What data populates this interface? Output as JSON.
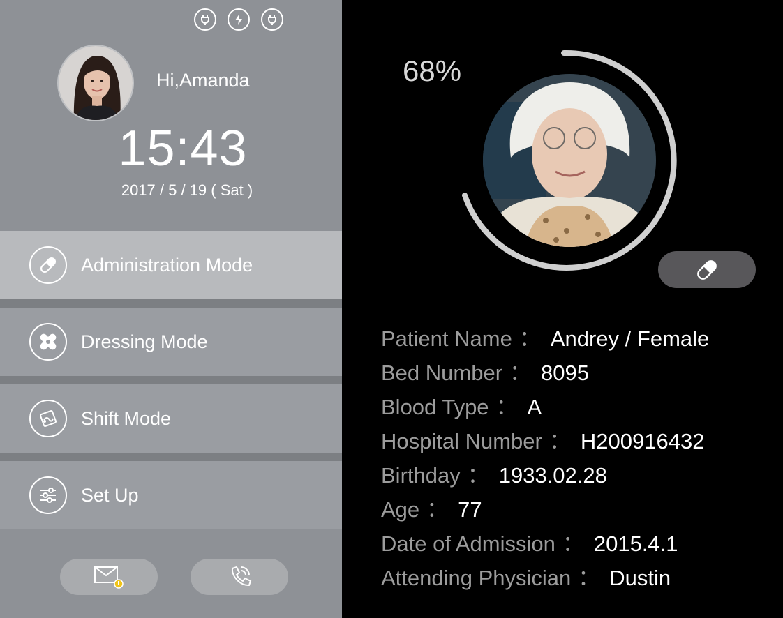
{
  "status_icons": [
    "plug-icon",
    "power-icon",
    "plug-icon"
  ],
  "user": {
    "greeting": "Hi,Amanda"
  },
  "clock": {
    "time": "15:43",
    "date": "2017 / 5 / 19 ( Sat )"
  },
  "menu": [
    {
      "label": "Administration Mode",
      "icon": "pill-icon",
      "active": true
    },
    {
      "label": "Dressing Mode",
      "icon": "bandage-icon",
      "active": false
    },
    {
      "label": "Shift Mode",
      "icon": "shift-icon",
      "active": false
    },
    {
      "label": "Set Up",
      "icon": "sliders-icon",
      "active": false
    }
  ],
  "bottom_buttons": [
    "mail-icon",
    "phone-icon"
  ],
  "progress": {
    "label": "68%",
    "value": 0.68
  },
  "patient": [
    {
      "key": "Patient Name",
      "value": "Andrey / Female"
    },
    {
      "key": "Bed Number",
      "value": "8095"
    },
    {
      "key": "Blood Type",
      "value": "A"
    },
    {
      "key": "Hospital Number",
      "value": "H200916432"
    },
    {
      "key": "Birthday",
      "value": "1933.02.28"
    },
    {
      "key": "Age",
      "value": "77"
    },
    {
      "key": "Date of Admission",
      "value": "2015.4.1"
    },
    {
      "key": "Attending Physician",
      "value": "Dustin"
    }
  ],
  "colors": {
    "left_panel": "#8e9196",
    "active_item": "#b8babd",
    "ring": "#cfcfcf",
    "background": "#000000"
  }
}
